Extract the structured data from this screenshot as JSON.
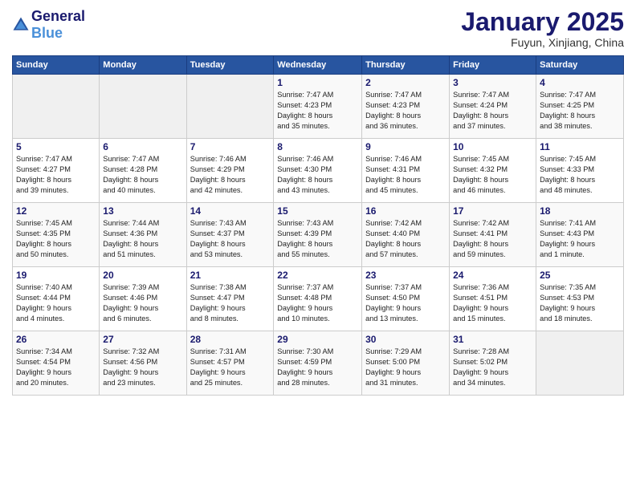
{
  "header": {
    "logo_general": "General",
    "logo_blue": "Blue",
    "month_title": "January 2025",
    "location": "Fuyun, Xinjiang, China"
  },
  "weekdays": [
    "Sunday",
    "Monday",
    "Tuesday",
    "Wednesday",
    "Thursday",
    "Friday",
    "Saturday"
  ],
  "weeks": [
    [
      {
        "day": "",
        "info": ""
      },
      {
        "day": "",
        "info": ""
      },
      {
        "day": "",
        "info": ""
      },
      {
        "day": "1",
        "info": "Sunrise: 7:47 AM\nSunset: 4:23 PM\nDaylight: 8 hours\nand 35 minutes."
      },
      {
        "day": "2",
        "info": "Sunrise: 7:47 AM\nSunset: 4:23 PM\nDaylight: 8 hours\nand 36 minutes."
      },
      {
        "day": "3",
        "info": "Sunrise: 7:47 AM\nSunset: 4:24 PM\nDaylight: 8 hours\nand 37 minutes."
      },
      {
        "day": "4",
        "info": "Sunrise: 7:47 AM\nSunset: 4:25 PM\nDaylight: 8 hours\nand 38 minutes."
      }
    ],
    [
      {
        "day": "5",
        "info": "Sunrise: 7:47 AM\nSunset: 4:27 PM\nDaylight: 8 hours\nand 39 minutes."
      },
      {
        "day": "6",
        "info": "Sunrise: 7:47 AM\nSunset: 4:28 PM\nDaylight: 8 hours\nand 40 minutes."
      },
      {
        "day": "7",
        "info": "Sunrise: 7:46 AM\nSunset: 4:29 PM\nDaylight: 8 hours\nand 42 minutes."
      },
      {
        "day": "8",
        "info": "Sunrise: 7:46 AM\nSunset: 4:30 PM\nDaylight: 8 hours\nand 43 minutes."
      },
      {
        "day": "9",
        "info": "Sunrise: 7:46 AM\nSunset: 4:31 PM\nDaylight: 8 hours\nand 45 minutes."
      },
      {
        "day": "10",
        "info": "Sunrise: 7:45 AM\nSunset: 4:32 PM\nDaylight: 8 hours\nand 46 minutes."
      },
      {
        "day": "11",
        "info": "Sunrise: 7:45 AM\nSunset: 4:33 PM\nDaylight: 8 hours\nand 48 minutes."
      }
    ],
    [
      {
        "day": "12",
        "info": "Sunrise: 7:45 AM\nSunset: 4:35 PM\nDaylight: 8 hours\nand 50 minutes."
      },
      {
        "day": "13",
        "info": "Sunrise: 7:44 AM\nSunset: 4:36 PM\nDaylight: 8 hours\nand 51 minutes."
      },
      {
        "day": "14",
        "info": "Sunrise: 7:43 AM\nSunset: 4:37 PM\nDaylight: 8 hours\nand 53 minutes."
      },
      {
        "day": "15",
        "info": "Sunrise: 7:43 AM\nSunset: 4:39 PM\nDaylight: 8 hours\nand 55 minutes."
      },
      {
        "day": "16",
        "info": "Sunrise: 7:42 AM\nSunset: 4:40 PM\nDaylight: 8 hours\nand 57 minutes."
      },
      {
        "day": "17",
        "info": "Sunrise: 7:42 AM\nSunset: 4:41 PM\nDaylight: 8 hours\nand 59 minutes."
      },
      {
        "day": "18",
        "info": "Sunrise: 7:41 AM\nSunset: 4:43 PM\nDaylight: 9 hours\nand 1 minute."
      }
    ],
    [
      {
        "day": "19",
        "info": "Sunrise: 7:40 AM\nSunset: 4:44 PM\nDaylight: 9 hours\nand 4 minutes."
      },
      {
        "day": "20",
        "info": "Sunrise: 7:39 AM\nSunset: 4:46 PM\nDaylight: 9 hours\nand 6 minutes."
      },
      {
        "day": "21",
        "info": "Sunrise: 7:38 AM\nSunset: 4:47 PM\nDaylight: 9 hours\nand 8 minutes."
      },
      {
        "day": "22",
        "info": "Sunrise: 7:37 AM\nSunset: 4:48 PM\nDaylight: 9 hours\nand 10 minutes."
      },
      {
        "day": "23",
        "info": "Sunrise: 7:37 AM\nSunset: 4:50 PM\nDaylight: 9 hours\nand 13 minutes."
      },
      {
        "day": "24",
        "info": "Sunrise: 7:36 AM\nSunset: 4:51 PM\nDaylight: 9 hours\nand 15 minutes."
      },
      {
        "day": "25",
        "info": "Sunrise: 7:35 AM\nSunset: 4:53 PM\nDaylight: 9 hours\nand 18 minutes."
      }
    ],
    [
      {
        "day": "26",
        "info": "Sunrise: 7:34 AM\nSunset: 4:54 PM\nDaylight: 9 hours\nand 20 minutes."
      },
      {
        "day": "27",
        "info": "Sunrise: 7:32 AM\nSunset: 4:56 PM\nDaylight: 9 hours\nand 23 minutes."
      },
      {
        "day": "28",
        "info": "Sunrise: 7:31 AM\nSunset: 4:57 PM\nDaylight: 9 hours\nand 25 minutes."
      },
      {
        "day": "29",
        "info": "Sunrise: 7:30 AM\nSunset: 4:59 PM\nDaylight: 9 hours\nand 28 minutes."
      },
      {
        "day": "30",
        "info": "Sunrise: 7:29 AM\nSunset: 5:00 PM\nDaylight: 9 hours\nand 31 minutes."
      },
      {
        "day": "31",
        "info": "Sunrise: 7:28 AM\nSunset: 5:02 PM\nDaylight: 9 hours\nand 34 minutes."
      },
      {
        "day": "",
        "info": ""
      }
    ]
  ]
}
